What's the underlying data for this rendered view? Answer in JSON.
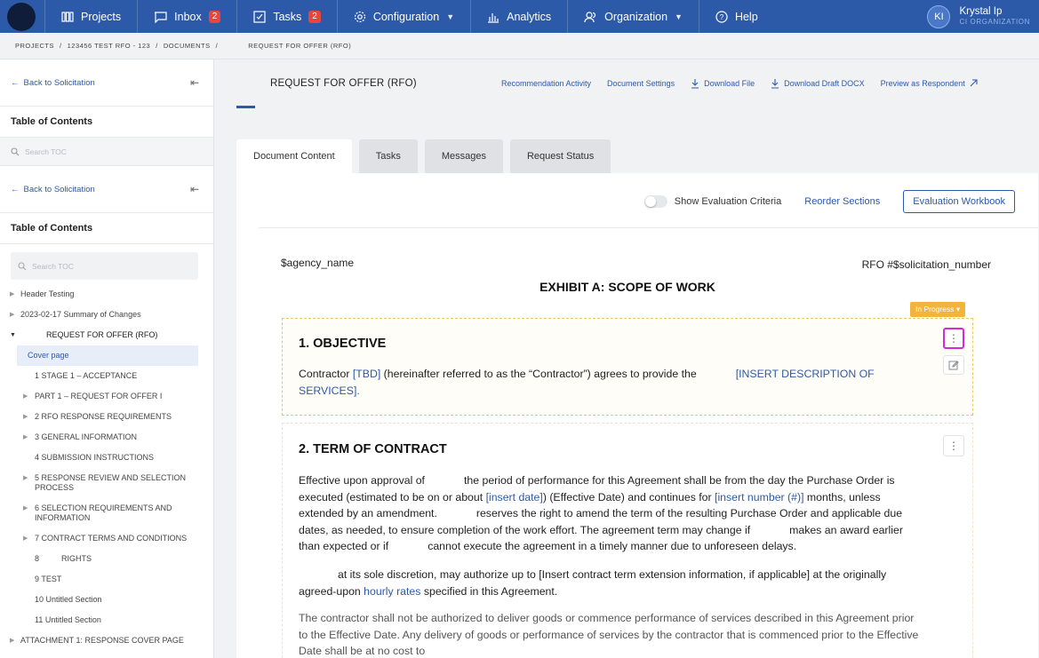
{
  "nav": {
    "items": [
      {
        "label": "Projects",
        "icon": "projects-icon"
      },
      {
        "label": "Inbox",
        "badge": "2",
        "icon": "inbox-icon"
      },
      {
        "label": "Tasks",
        "badge": "2",
        "icon": "tasks-icon"
      },
      {
        "label": "Configuration",
        "icon": "gear-icon"
      },
      {
        "label": "Analytics",
        "icon": "analytics-icon"
      },
      {
        "label": "Organization",
        "icon": "organization-icon"
      },
      {
        "label": "Help",
        "icon": "help-icon"
      }
    ],
    "user": {
      "initials": "KI",
      "name": "Krystal Ip",
      "org": "CI ORGANIZATION"
    }
  },
  "breadcrumb": {
    "projects": "PROJECTS",
    "sep": "/",
    "project": "123456 TEST RFO - 123",
    "documents": "DOCUMENTS",
    "current": "REQUEST FOR OFFER (RFO)"
  },
  "sidebar": {
    "back_label": "Back to Solicitation",
    "toc_title": "Table of Contents",
    "search_placeholder": "Search TOC",
    "items": [
      "Header Testing",
      "2023-02-17 Summary of Changes",
      "REQUEST FOR OFFER (RFO)",
      "Cover page",
      "1 STAGE 1 – ACCEPTANCE",
      "PART 1 – REQUEST FOR OFFER I",
      "2 RFO RESPONSE REQUIREMENTS",
      "3 GENERAL INFORMATION",
      "4 SUBMISSION INSTRUCTIONS",
      "5 RESPONSE REVIEW AND SELECTION PROCESS",
      "6 SELECTION REQUIREMENTS AND INFORMATION",
      "7 CONTRACT TERMS AND CONDITIONS",
      "8          RIGHTS",
      "9 TEST",
      "10 Untitled Section",
      "11 Untitled Section",
      "ATTACHMENT 1: RESPONSE COVER PAGE"
    ]
  },
  "doc": {
    "title": "REQUEST FOR OFFER (RFO)",
    "actions": [
      "Recommendation Activity",
      "Document Settings",
      "Download File",
      "Download Draft DOCX",
      "Preview as Respondent"
    ],
    "tabs": [
      "Document Content",
      "Tasks",
      "Messages",
      "Request Status"
    ],
    "toggle_label": "Show Evaluation Criteria",
    "reorder_label": "Reorder Sections",
    "eval_label": "Evaluation Workbook",
    "agency": "$agency_name",
    "rfo_number": "RFO #$solicitation_number",
    "exhibit": "EXHIBIT A: SCOPE OF WORK",
    "status": "In Progress",
    "s1": {
      "title": "1. OBJECTIVE",
      "p1a": "Contractor ",
      "p1b": "[TBD]",
      "p1c": " (hereinafter referred to as the “Contractor”) agrees to provide the",
      "p1d": "[INSERT DESCRIPTION OF SERVICES]",
      "p1e": "."
    },
    "s2": {
      "title": "2. TERM OF CONTRACT",
      "p1a": "Effective upon approval of",
      "p1b": "the period of performance for this Agreement shall be from the day the Purchase Order is executed (estimated to be on or about ",
      "p1c": "[insert date]",
      "p1d": ") (Effective Date) and continues for ",
      "p1e": "[insert number (#)]",
      "p1f": " months, unless extended by an amendment.",
      "p1g": "reserves the right to amend the term of the resulting Purchase Order and applicable due dates, as needed, to ensure completion of the work effort. The agreement term may change if",
      "p1h": "makes an award earlier than expected or if",
      "p1i": "cannot execute the agreement in a timely manner due to unforeseen delays.",
      "p2a": "at its sole discretion, may authorize up to [Insert contract term extension information, if applicable] at the originally agreed-upon ",
      "p2b": "hourly rates",
      "p2c": " specified in this Agreement.",
      "p3": "The contractor shall not be authorized to deliver goods or commence performance of services described in this Agreement prior to the Effective Date. Any delivery of goods or performance of services by the contractor that is commenced prior to the Effective Date shall be at no cost to"
    }
  }
}
